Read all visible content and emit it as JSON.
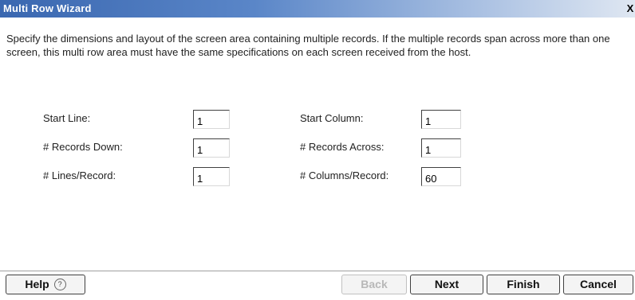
{
  "window": {
    "title": "Multi Row Wizard",
    "close_label": "X"
  },
  "description": "Specify the dimensions and layout of the screen area containing multiple records. If the multiple records span across more than one screen, this multi row area must have the same specifications on each screen received from the host.",
  "fields": {
    "start_line": {
      "label": "Start Line:",
      "value": "1"
    },
    "records_down": {
      "label": "# Records Down:",
      "value": "1"
    },
    "lines_per_record": {
      "label": "# Lines/Record:",
      "value": "1"
    },
    "start_column": {
      "label": "Start Column:",
      "value": "1"
    },
    "records_across": {
      "label": "# Records Across:",
      "value": "1"
    },
    "columns_per_record": {
      "label": "# Columns/Record:",
      "value": "60"
    }
  },
  "buttons": {
    "help": "Help",
    "help_icon": "?",
    "back": "Back",
    "next": "Next",
    "finish": "Finish",
    "cancel": "Cancel"
  }
}
